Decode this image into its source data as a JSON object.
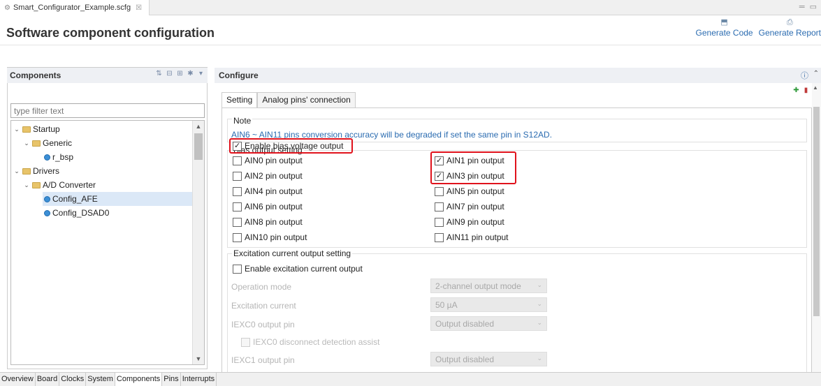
{
  "editor_tab": {
    "filename": "Smart_Configurator_Example.scfg",
    "close_glyph": "☒"
  },
  "header": {
    "title": "Software component configuration",
    "generate_code": "Generate Code",
    "generate_report": "Generate Report"
  },
  "components": {
    "title": "Components",
    "filter_placeholder": "type filter text",
    "tree": [
      {
        "label": "Startup",
        "level": 0,
        "type": "folder",
        "expanded": true
      },
      {
        "label": "Generic",
        "level": 1,
        "type": "folder",
        "expanded": true
      },
      {
        "label": "r_bsp",
        "level": 2,
        "type": "component"
      },
      {
        "label": "Drivers",
        "level": 0,
        "type": "folder",
        "expanded": true
      },
      {
        "label": "A/D Converter",
        "level": 1,
        "type": "folder",
        "expanded": true
      },
      {
        "label": "Config_AFE",
        "level": 2,
        "type": "component",
        "selected": true
      },
      {
        "label": "Config_DSAD0",
        "level": 2,
        "type": "component"
      }
    ]
  },
  "configure": {
    "title": "Configure",
    "tabs": [
      "Setting",
      "Analog pins' connection"
    ],
    "note_label": "Note",
    "note_text": "AIN6 ~ AIN11 pins conversion accuracy will be degraded if set the same pin in S12AD.",
    "bias_label": "Bias output setting",
    "enable_bias": {
      "label": "Enable bias voltage output",
      "checked": true
    },
    "pins": [
      {
        "label": "AIN0 pin output",
        "checked": false
      },
      {
        "label": "AIN1 pin output",
        "checked": true
      },
      {
        "label": "AIN2 pin output",
        "checked": false
      },
      {
        "label": "AIN3 pin output",
        "checked": true
      },
      {
        "label": "AIN4 pin output",
        "checked": false
      },
      {
        "label": "AIN5 pin output",
        "checked": false
      },
      {
        "label": "AIN6 pin output",
        "checked": false
      },
      {
        "label": "AIN7 pin output",
        "checked": false
      },
      {
        "label": "AIN8 pin output",
        "checked": false
      },
      {
        "label": "AIN9 pin output",
        "checked": false
      },
      {
        "label": "AIN10 pin output",
        "checked": false
      },
      {
        "label": "AIN11 pin output",
        "checked": false
      }
    ],
    "excitation_label": "Excitation current output setting",
    "enable_excitation": {
      "label": "Enable excitation current output",
      "checked": false
    },
    "fields": [
      {
        "label": "Operation mode",
        "value": "2-channel output mode"
      },
      {
        "label": "Excitation current",
        "value": "50 µA"
      },
      {
        "label": "IEXC0 output pin",
        "value": "Output disabled"
      },
      {
        "label": "IEXC1 output pin",
        "value": "Output disabled"
      }
    ],
    "iexc0_assist": "IEXC0 disconnect detection assist"
  },
  "bottom_tabs": [
    "Overview",
    "Board",
    "Clocks",
    "System",
    "Components",
    "Pins",
    "Interrupts"
  ],
  "colors": {
    "highlight": "#e0121c",
    "link": "#2a6bb0",
    "selection": "#dbe8f7"
  }
}
